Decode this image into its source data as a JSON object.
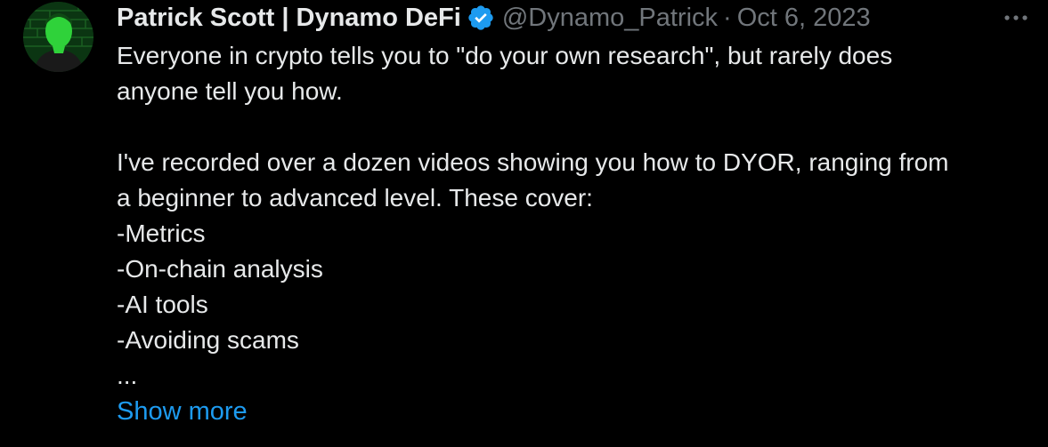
{
  "tweet": {
    "author": {
      "display_name": "Patrick Scott | Dynamo DeFi",
      "handle": "@Dynamo_Patrick",
      "verified_icon": "verified-badge-icon",
      "avatar_icon": "avatar"
    },
    "separator": "·",
    "date": "Oct 6, 2023",
    "more_icon": "more-options-icon",
    "body": {
      "line1": "Everyone in crypto tells you to \"do your own research\", but rarely does",
      "line2": "anyone tell you how.",
      "line3": "I've recorded over a dozen videos showing you how to DYOR, ranging from",
      "line4": "a beginner to advanced level. These cover:",
      "line5": "-Metrics",
      "line6": "-On-chain analysis",
      "line7": "-AI tools",
      "line8": "-Avoiding scams",
      "line9": "..."
    },
    "show_more": "Show more"
  },
  "colors": {
    "background": "#000000",
    "text": "#e7e9ea",
    "secondary_text": "#71767b",
    "link": "#1d9bf0",
    "verified": "#1d9bf0"
  }
}
